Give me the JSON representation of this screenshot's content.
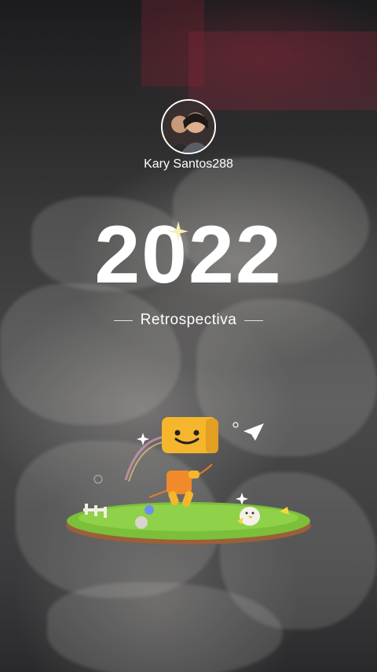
{
  "profile": {
    "username": "Kary Santos288",
    "avatar_icon": "profile-photo"
  },
  "hero": {
    "year": "2022",
    "subtitle": "Retrospectiva"
  },
  "colors": {
    "text": "#ffffff",
    "mascot": "#f5b62d",
    "grass": "#7cbf3a"
  }
}
